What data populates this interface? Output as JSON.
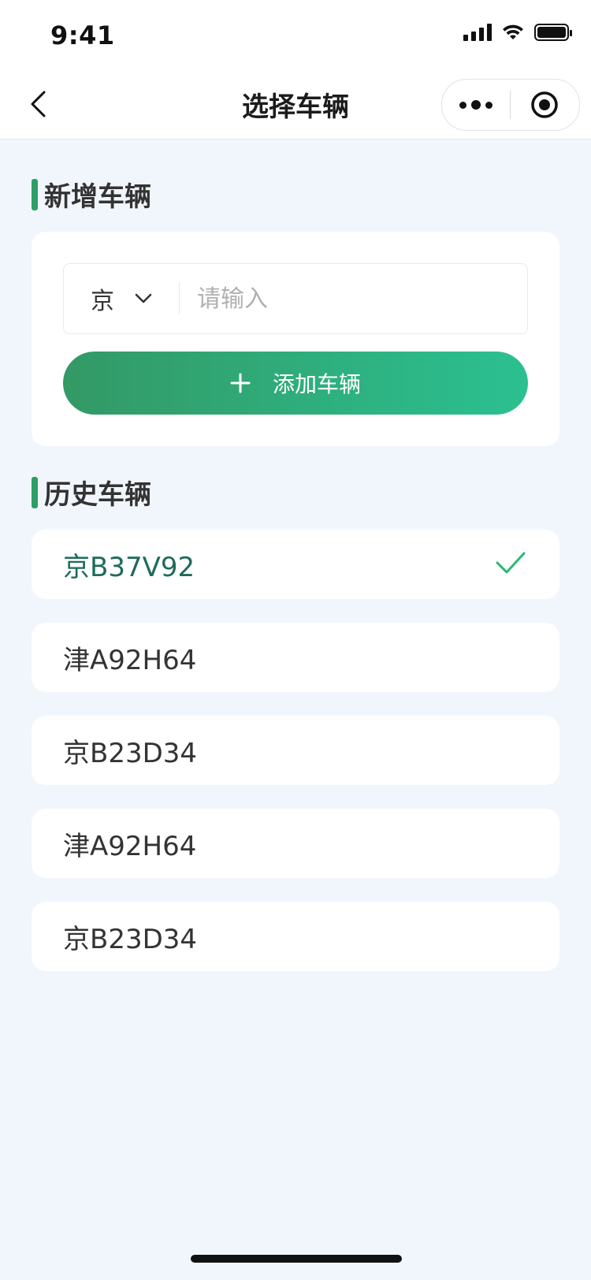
{
  "status_bar": {
    "time": "9:41"
  },
  "nav": {
    "title": "选择车辆"
  },
  "sections": {
    "add_title": "新增车辆",
    "history_title": "历史车辆"
  },
  "add_form": {
    "province": "京",
    "input_placeholder": "请输入",
    "input_value": "",
    "add_button_label": "添加车辆"
  },
  "history": {
    "items": [
      {
        "plate": "京B37V92",
        "selected": true
      },
      {
        "plate": "津A92H64",
        "selected": false
      },
      {
        "plate": "京B23D34",
        "selected": false
      },
      {
        "plate": "津A92H64",
        "selected": false
      },
      {
        "plate": "京B23D34",
        "selected": false
      }
    ]
  },
  "colors": {
    "accent": "#2E9E69",
    "selected_text": "#1E6B5A",
    "page_bg": "#F1F6FD"
  }
}
